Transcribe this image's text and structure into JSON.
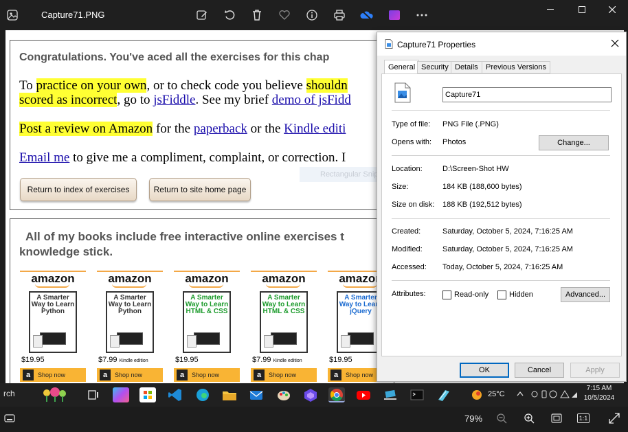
{
  "viewer": {
    "title": "Capture71.PNG",
    "zoom": "79%",
    "toolbar_icons": [
      "edit-icon",
      "rotate-icon",
      "delete-icon",
      "favorite-icon",
      "info-icon",
      "print-icon",
      "onedrive-icon",
      "clipchamp-icon",
      "more-icon"
    ]
  },
  "page": {
    "congrats": "Congratulations. You've aced all the exercises for this chap",
    "p1_a": "To ",
    "p1_hl": "practice on your own",
    "p1_b": ", or to check code you believe ",
    "p1_hl2": "shouldn",
    "p1_hl3": "scored as incorrect",
    "p1_c": ", go to ",
    "p1_link1": "jsFiddle",
    "p1_d": ". See my brief ",
    "p1_link2": "demo of jsFidd",
    "p2_hl": "Post a review on Amazon",
    "p2_a": " for the ",
    "p2_link1": "paperback",
    "p2_b": " or the ",
    "p2_link2": "Kindle editi",
    "p3_link": "Email me",
    "p3_a": " to give me a compliment, complaint, or correction. I",
    "btn_index": "Return to index of exercises",
    "btn_home": "Return to site home page",
    "snip_ghost": "Rectangular Snip",
    "books_heading_1": "All of my books include free interactive online exercises t",
    "books_heading_2": "knowledge stick.",
    "books": [
      {
        "brand": "amazon",
        "title": "A Smarter Way to Learn Python",
        "price": "$19.95",
        "kindle": "",
        "shop": "Shop now",
        "color": "#333333"
      },
      {
        "brand": "amazon",
        "title": "A Smarter Way to Learn Python",
        "price": "$7.99",
        "kindle": "Kindle edition",
        "shop": "Shop now",
        "color": "#333333"
      },
      {
        "brand": "amazon",
        "title": "A Smarter Way to Learn HTML & CSS",
        "price": "$19.95",
        "kindle": "",
        "shop": "Shop now",
        "color": "#1a9a2a"
      },
      {
        "brand": "amazon",
        "title": "A Smarter Way to Learn HTML & CSS",
        "price": "$7.99",
        "kindle": "Kindle edition",
        "shop": "Shop now",
        "color": "#1a9a2a"
      },
      {
        "brand": "amazon",
        "title": "A Smarter Way to Learn jQuery",
        "price": "$19.95",
        "kindle": "",
        "shop": "Shop now",
        "color": "#1a6ad0"
      }
    ]
  },
  "dialog": {
    "title": "Capture71 Properties",
    "tabs": [
      "General",
      "Security",
      "Details",
      "Previous Versions"
    ],
    "filename": "Capture71",
    "type_label": "Type of file:",
    "type_value": "PNG File (.PNG)",
    "opens_label": "Opens with:",
    "opens_value": "Photos",
    "change_btn": "Change...",
    "location_label": "Location:",
    "location_value": "D:\\Screen-Shot HW",
    "size_label": "Size:",
    "size_value": "184 KB (188,600 bytes)",
    "disk_label": "Size on disk:",
    "disk_value": "188 KB (192,512 bytes)",
    "created_label": "Created:",
    "created_value": "Saturday, October 5, 2024, 7:16:25 AM",
    "modified_label": "Modified:",
    "modified_value": "Saturday, October 5, 2024, 7:16:25 AM",
    "accessed_label": "Accessed:",
    "accessed_value": "Today, October 5, 2024, 7:16:25 AM",
    "attributes_label": "Attributes:",
    "readonly_label": "Read-only",
    "hidden_label": "Hidden",
    "advanced_btn": "Advanced...",
    "ok_btn": "OK",
    "cancel_btn": "Cancel",
    "apply_btn": "Apply"
  },
  "taskbar": {
    "search_fragment": "rch",
    "weather": "25°C",
    "time": "7:15 AM",
    "date": "10/5/2024"
  },
  "statusbar": {
    "zoom": "79%",
    "actual_size": "1:1"
  }
}
